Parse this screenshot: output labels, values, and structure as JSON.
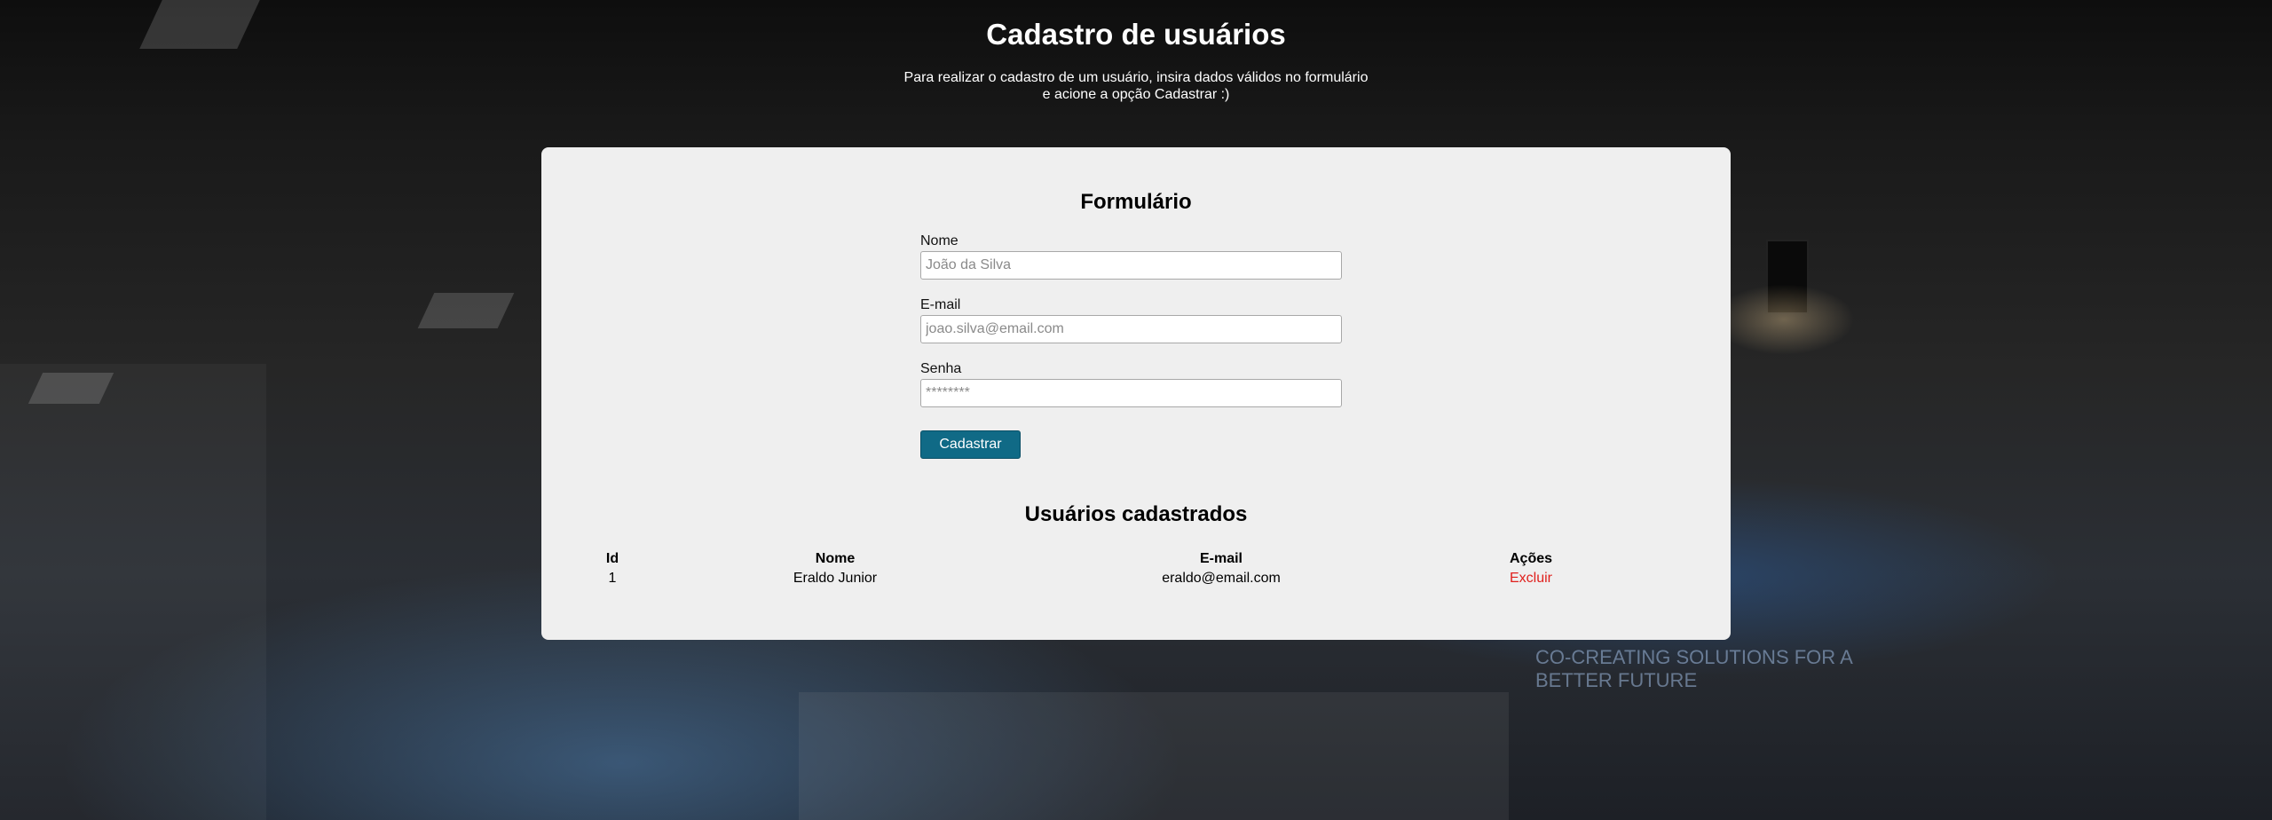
{
  "header": {
    "title": "Cadastro de usuários",
    "intro_line1": "Para realizar o cadastro de um usuário, insira dados válidos no formulário",
    "intro_line2": "e acione a opção Cadastrar :)"
  },
  "form": {
    "title": "Formulário",
    "fields": [
      {
        "label": "Nome",
        "placeholder": "João da Silva"
      },
      {
        "label": "E-mail",
        "placeholder": "joao.silva@email.com"
      },
      {
        "label": "Senha",
        "placeholder": "********"
      }
    ],
    "submit_label": "Cadastrar"
  },
  "users": {
    "title": "Usuários cadastrados",
    "columns": [
      "Id",
      "Nome",
      "E-mail",
      "Ações"
    ],
    "rows": [
      {
        "id": "1",
        "nome": "Eraldo Junior",
        "email": "eraldo@email.com",
        "action": "Excluir"
      }
    ]
  },
  "background": {
    "sign_text": "#",
    "sign_subtitle": "CO-CREATING SOLUTIONS FOR A BETTER FUTURE"
  },
  "colors": {
    "card_bg": "#efefef",
    "button_bg": "#106a86",
    "delete_link": "#e0201d",
    "header_text": "#ffffff"
  }
}
